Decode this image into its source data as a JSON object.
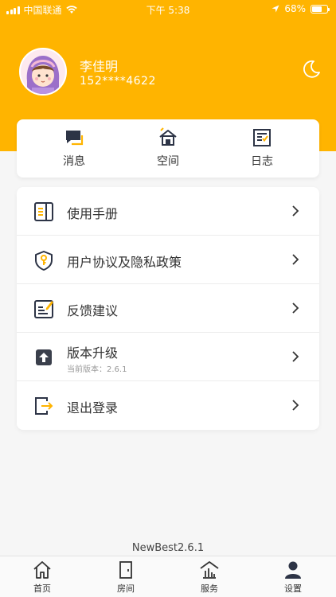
{
  "status_bar": {
    "carrier": "中国联通",
    "time": "下午 5:38",
    "battery": "68%",
    "battery_level": 0.68
  },
  "profile": {
    "name": "李佳明",
    "phone": "152****4622"
  },
  "quick_actions": [
    {
      "label": "消息",
      "icon": "message-icon"
    },
    {
      "label": "空间",
      "icon": "home-space-icon"
    },
    {
      "label": "日志",
      "icon": "log-icon"
    }
  ],
  "menu": {
    "items": [
      {
        "label": "使用手册",
        "icon": "manual-icon"
      },
      {
        "label": "用户协议及隐私政策",
        "icon": "shield-key-icon"
      },
      {
        "label": "反馈建议",
        "icon": "feedback-icon"
      },
      {
        "label": "版本升级",
        "sublabel": "当前版本：2.6.1",
        "icon": "upgrade-icon"
      },
      {
        "label": "退出登录",
        "icon": "logout-icon"
      }
    ]
  },
  "app_version": "NewBest2.6.1",
  "tab_bar": {
    "tabs": [
      {
        "label": "首页",
        "icon": "home-icon"
      },
      {
        "label": "房间",
        "icon": "door-icon"
      },
      {
        "label": "服务",
        "icon": "service-icon"
      },
      {
        "label": "设置",
        "icon": "user-settings-icon",
        "active": true
      }
    ]
  },
  "colors": {
    "accent": "#ffb400",
    "icon_dark": "#2d3446",
    "text": "#333333",
    "sub_text": "#999999"
  }
}
